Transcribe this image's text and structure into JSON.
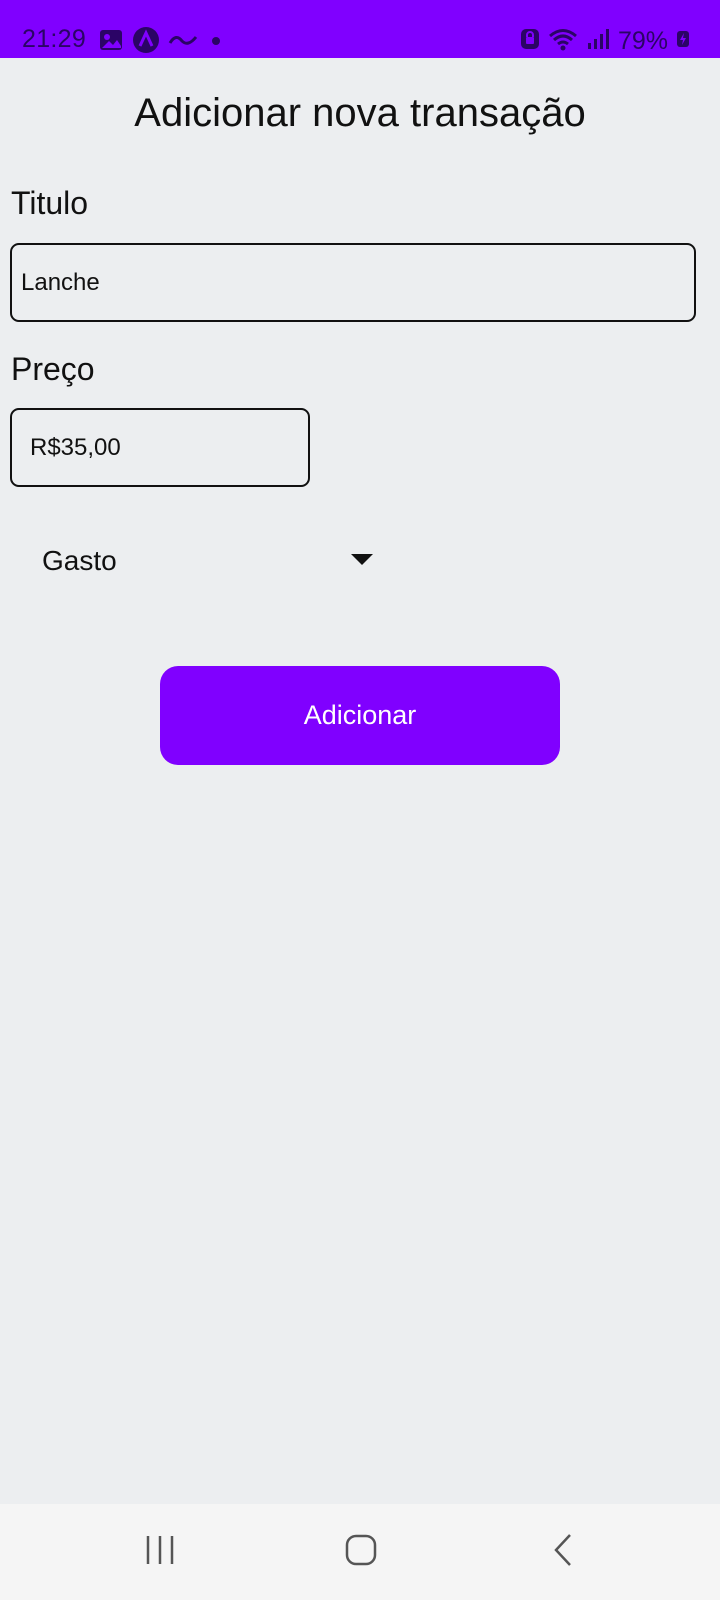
{
  "status_bar": {
    "time": "21:29",
    "battery_percent": "79%",
    "left_icons": [
      "gallery-icon",
      "app-a-icon",
      "app-logo-icon",
      "notification-dot-icon"
    ],
    "right_icons": [
      "lock-icon",
      "wifi-icon",
      "signal-icon",
      "battery-charging-icon"
    ],
    "background_color": "#8000FF"
  },
  "page": {
    "title": "Adicionar nova transação"
  },
  "form": {
    "titulo_label": "Titulo",
    "titulo_value": "Lanche",
    "preco_label": "Preço",
    "preco_value": "R$35,00",
    "tipo_selected": "Gasto"
  },
  "actions": {
    "add_label": "Adicionar",
    "add_color": "#8000FF"
  },
  "nav_bar": {
    "buttons": [
      "recents-icon",
      "home-icon",
      "back-icon"
    ]
  }
}
